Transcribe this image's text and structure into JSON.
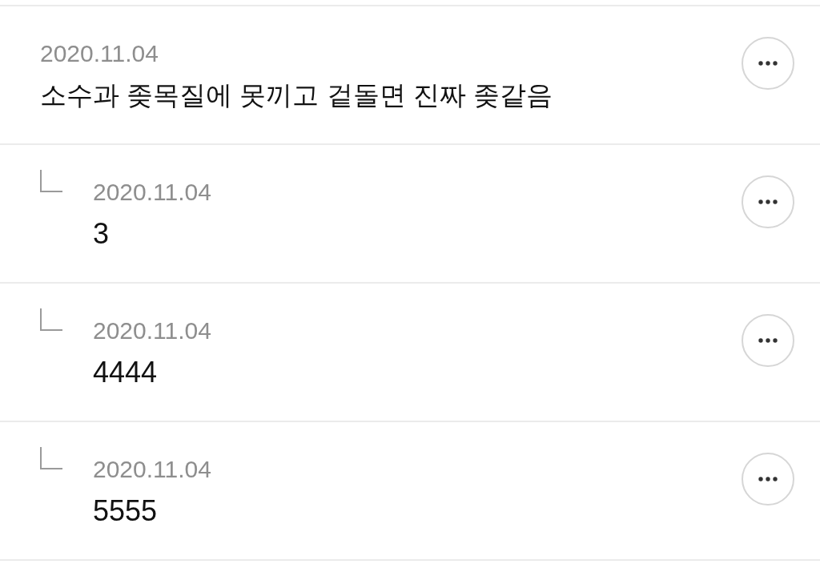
{
  "comments": [
    {
      "kind": "comment",
      "date": "2020.11.04",
      "text": "소수과 좆목질에 못끼고 겉돌면 진짜 좆같음"
    },
    {
      "kind": "reply",
      "date": "2020.11.04",
      "text": "3"
    },
    {
      "kind": "reply",
      "date": "2020.11.04",
      "text": "4444"
    },
    {
      "kind": "reply",
      "date": "2020.11.04",
      "text": "5555"
    }
  ]
}
